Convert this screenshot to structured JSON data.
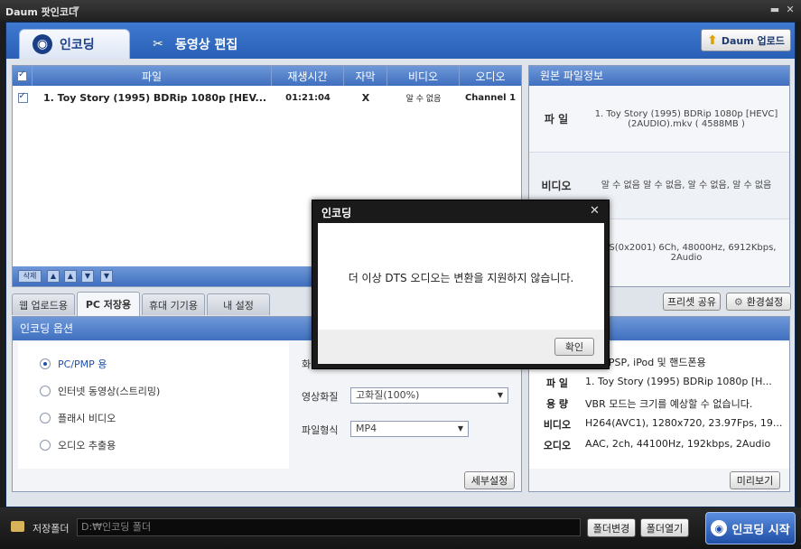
{
  "app": {
    "title": "Daum 팟인코더"
  },
  "tabs": {
    "encoding": "인코딩",
    "video_edit": "동영상 편집"
  },
  "daum_upload_label": "Daum 업로드",
  "file_list": {
    "columns": [
      "파일",
      "재생시간",
      "자막",
      "비디오",
      "오디오"
    ],
    "rows": [
      {
        "checked": true,
        "name": "1. Toy Story (1995) BDRip 1080p [HEV...",
        "duration": "01:21:04",
        "subtitle": "X",
        "video": "알 수 없음",
        "audio": "Channel 1"
      }
    ],
    "tools": {
      "delete": "삭제",
      "top": "▲",
      "up": "▲",
      "down": "▼",
      "bottom": "▼"
    }
  },
  "source_info": {
    "header": "원본 파일정보",
    "file_label": "파 일",
    "file_value": "1. Toy Story (1995) BDRip 1080p [HEVC] (2AUDIO).mkv ( 4588MB )",
    "video_label": "비디오",
    "video_value": "알 수 없음 알 수 없음, 알 수 없음, 알 수 없음",
    "audio_value": "DTS(0x2001) 6Ch, 48000Hz, 6912Kbps, 2Audio"
  },
  "sub_tabs": [
    "웹 업로드용",
    "PC 저장용",
    "휴대 기기용",
    "내 설정"
  ],
  "preset_share": "프리셋 공유",
  "env_settings": "환경설정",
  "encoding_options": {
    "header": "인코딩 옵션",
    "radios": [
      "PC/PMP 용",
      "인터넷 동영상(스트리밍)",
      "플래시 비디오",
      "오디오 추출용"
    ],
    "partial_label": "화",
    "quality_label": "영상화질",
    "quality_value": "고화질(100%)",
    "format_label": "파일형식",
    "format_value": "MP4",
    "detail_button": "세부설정"
  },
  "result": {
    "header_partial": "과",
    "rows": [
      {
        "label": "",
        "value": "P4]PSP, iPod 및 핸드폰용"
      },
      {
        "label": "파 일",
        "value": "1. Toy Story (1995) BDRip 1080p [H..."
      },
      {
        "label": "용 량",
        "value": "VBR 모드는 크기를 예상할 수 없습니다."
      },
      {
        "label": "비디오",
        "value": "H264(AVC1), 1280x720, 23.97Fps, 19..."
      },
      {
        "label": "오디오",
        "value": "AAC, 2ch, 44100Hz, 192kbps, 2Audio"
      }
    ],
    "preview_button": "미리보기"
  },
  "bottom": {
    "folder_label": "저장폴더",
    "folder_path": "D:₩인코딩 폴더",
    "change_folder": "폴더변경",
    "open_folder": "폴더열기",
    "start": "인코딩 시작"
  },
  "dialog": {
    "title": "인코딩",
    "message": "더 이상 DTS 오디오는 변환을 지원하지 않습니다.",
    "ok": "확인"
  }
}
